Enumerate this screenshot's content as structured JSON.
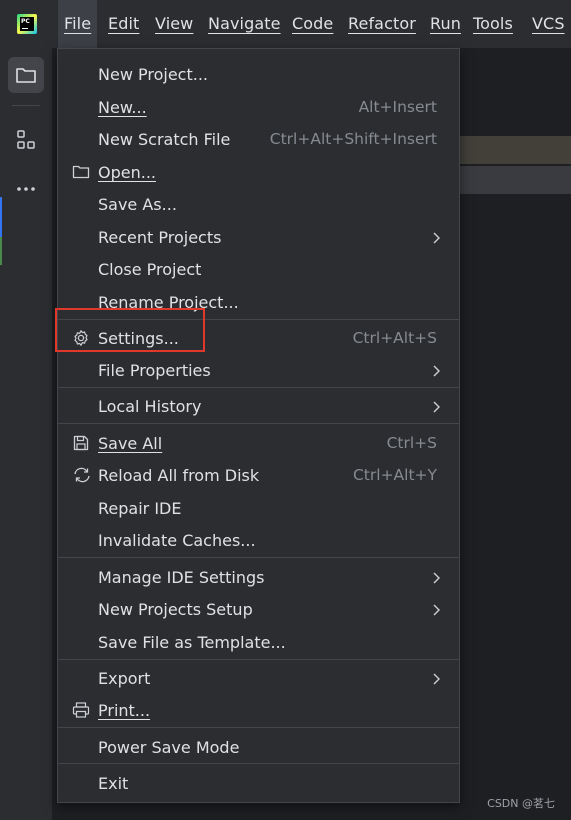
{
  "app": {
    "logo_text": "PC"
  },
  "menubar": {
    "items": [
      {
        "label": "File"
      },
      {
        "label": "Edit"
      },
      {
        "label": "View"
      },
      {
        "label": "Navigate"
      },
      {
        "label": "Code"
      },
      {
        "label": "Refactor"
      },
      {
        "label": "Run"
      },
      {
        "label": "Tools"
      },
      {
        "label": "VCS"
      }
    ]
  },
  "toolstrip": {
    "icons": [
      "project-folder-icon",
      "structure-icon",
      "more-icon"
    ]
  },
  "file_menu": {
    "items": [
      {
        "label": "New Project...",
        "shortcut": ""
      },
      {
        "label": "New...",
        "shortcut": "Alt+Insert"
      },
      {
        "label": "New Scratch File",
        "shortcut": "Ctrl+Alt+Shift+Insert"
      },
      {
        "label": "Open...",
        "shortcut": "",
        "icon": "folder-icon"
      },
      {
        "label": "Save As...",
        "shortcut": ""
      },
      {
        "label": "Recent Projects",
        "submenu": true
      },
      {
        "label": "Close Project",
        "shortcut": ""
      },
      {
        "label": "Rename Project...",
        "shortcut": ""
      },
      {
        "label": "Settings...",
        "shortcut": "Ctrl+Alt+S",
        "icon": "gear-icon"
      },
      {
        "label": "File Properties",
        "submenu": true
      },
      {
        "label": "Local History",
        "submenu": true
      },
      {
        "label": "Save All",
        "shortcut": "Ctrl+S",
        "icon": "save-icon"
      },
      {
        "label": "Reload All from Disk",
        "shortcut": "Ctrl+Alt+Y",
        "icon": "reload-icon"
      },
      {
        "label": "Repair IDE",
        "shortcut": ""
      },
      {
        "label": "Invalidate Caches...",
        "shortcut": ""
      },
      {
        "label": "Manage IDE Settings",
        "submenu": true
      },
      {
        "label": "New Projects Setup",
        "submenu": true
      },
      {
        "label": "Save File as Template...",
        "shortcut": ""
      },
      {
        "label": "Export",
        "submenu": true
      },
      {
        "label": "Print...",
        "shortcut": "",
        "icon": "printer-icon"
      },
      {
        "label": "Power Save Mode",
        "shortcut": ""
      },
      {
        "label": "Exit",
        "shortcut": ""
      }
    ]
  },
  "highlight_color": "#e0392b",
  "watermark": "CSDN @茗七"
}
